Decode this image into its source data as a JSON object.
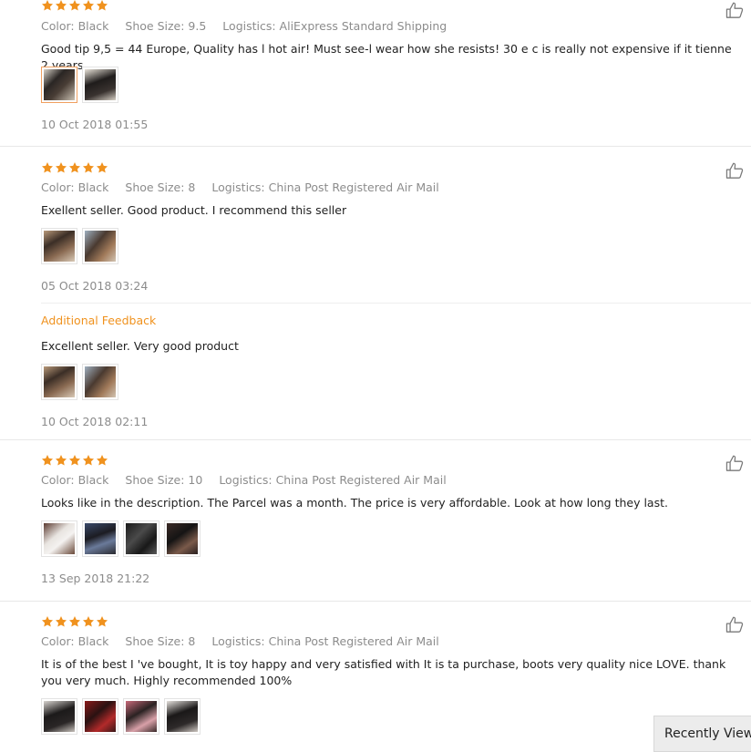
{
  "reviews": [
    {
      "rating": 5,
      "color_label": "Color: Black",
      "size_label": "Shoe Size: 9.5",
      "logistics_label": "Logistics: AliExpress Standard Shipping",
      "text": "Good tip 9,5 = 44 Europe, Quality has l hot air! Must see-l wear how she resists! 30 e c is really not expensive if it tienne 2 years",
      "date": "10 Oct 2018 01:55"
    },
    {
      "rating": 5,
      "color_label": "Color: Black",
      "size_label": "Shoe Size: 8",
      "logistics_label": "Logistics: China Post Registered Air Mail",
      "text": "Exellent seller. Good product. I recommend this seller",
      "date": "05 Oct 2018 03:24",
      "additional": {
        "label": "Additional Feedback",
        "text": "Excellent seller. Very good product",
        "date": "10 Oct 2018 02:11"
      }
    },
    {
      "rating": 5,
      "color_label": "Color: Black",
      "size_label": "Shoe Size: 10",
      "logistics_label": "Logistics: China Post Registered Air Mail",
      "text": "Looks like in the description. The Parcel was a month. The price is very affordable. Look at how long they last.",
      "date": "13 Sep 2018 21:22"
    },
    {
      "rating": 5,
      "color_label": "Color: Black",
      "size_label": "Shoe Size: 8",
      "logistics_label": "Logistics: China Post Registered Air Mail",
      "text": "It is of the best I 've bought, It is toy happy and very satisfied with It is ta purchase, boots very quality nice LOVE. thank you very much. Highly recommended 100%"
    }
  ],
  "recently_viewed_label": "Recently Viewed",
  "colors": {
    "star": "#f0921e",
    "accent": "#f0921e"
  },
  "icons": {
    "rating": "star-icon",
    "helpful": "thumbs-up-icon"
  }
}
